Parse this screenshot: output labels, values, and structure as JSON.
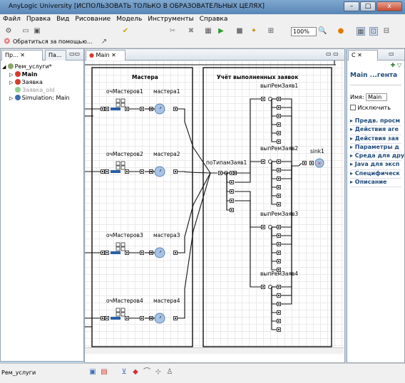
{
  "window": {
    "title": "AnyLogic University [ИСПОЛЬЗОВАТЬ ТОЛЬКО В ОБРАЗОВАТЕЛЬНЫХ ЦЕЛЯХ]",
    "minimize": "–",
    "maximize": "□",
    "close": "x"
  },
  "menu": [
    "Файл",
    "Правка",
    "Вид",
    "Рисование",
    "Модель",
    "Инструменты",
    "Справка"
  ],
  "toolbar": {
    "zoom": "100%",
    "help_label": "Обратиться за помощью..."
  },
  "projects": {
    "tab1": "Пр...",
    "tab2": "Па...",
    "tree": [
      {
        "label": "Рем_услуги*",
        "bold": false,
        "color": "#000"
      },
      {
        "label": "Main",
        "bold": true,
        "color": "#000"
      },
      {
        "label": "Заявка",
        "bold": false,
        "color": "#000"
      },
      {
        "label": "Заявка_old",
        "bold": false,
        "color": "#9a9a9a"
      },
      {
        "label": "Simulation: Main",
        "bold": false,
        "color": "#000"
      }
    ]
  },
  "editor": {
    "tab": "Main"
  },
  "diagram": {
    "group_left": "Мастера",
    "group_right": "Учёт выполненных заявок",
    "queues": [
      "очМастеров1",
      "очМастеров2",
      "очМастеров3",
      "очМастеров4"
    ],
    "delays": [
      "мастера1",
      "мастера2",
      "мастера3",
      "мастера4"
    ],
    "selector": "поТипамЗаяв1",
    "outputs": [
      "выпРемЗаяв1",
      "выпРемЗаяв2",
      "выпРемЗаяв3",
      "выпРемЗаяв4"
    ],
    "sink": "sink1"
  },
  "properties": {
    "tab": "С",
    "title": "Main ...гента",
    "name_label": "Имя:",
    "name_value": "Main",
    "exclude": "Исключить",
    "sections": [
      "Предв. просм",
      "Действия аге",
      "Действия зая",
      "Параметры д",
      "Среда для дру",
      "Java для эксп",
      "Специфическ",
      "Описание"
    ]
  },
  "status": {
    "text": "Рем_услуги"
  }
}
